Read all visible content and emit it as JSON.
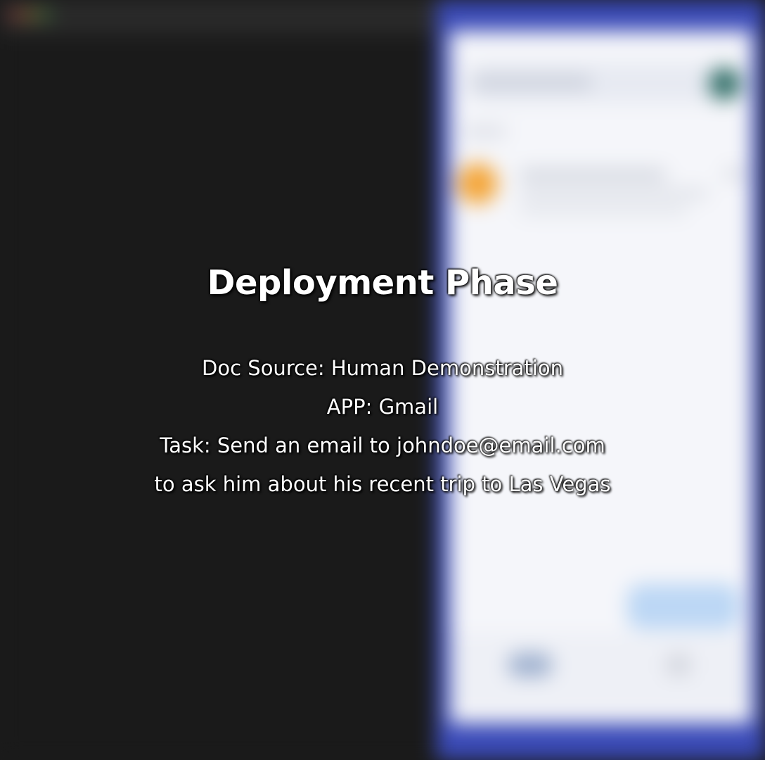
{
  "overlay": {
    "title": "Deployment Phase",
    "doc_source": "Doc Source: Human Demonstration",
    "app": "APP: Gmail",
    "task_line1": "Task: Send an email to johndoe@email.com",
    "task_line2": "to ask him about his recent trip to Las Vegas"
  },
  "colors": {
    "desktop_background": "#1a1a1a",
    "phone_frame": "#3b4bb8",
    "phone_screen": "#f5f6fa",
    "sender_avatar": "#f4a63a",
    "account_avatar": "#2f6d66",
    "compose_button": "#bcd7f5",
    "overlay_text": "#ffffff"
  },
  "icons": {
    "window_controls": [
      "close-dot-icon",
      "minimize-dot-icon",
      "maximize-dot-icon"
    ],
    "sender_avatar": "avatar-icon",
    "account_avatar": "account-avatar-icon",
    "bottom_nav": [
      "mail-icon",
      "meet-icon"
    ]
  }
}
